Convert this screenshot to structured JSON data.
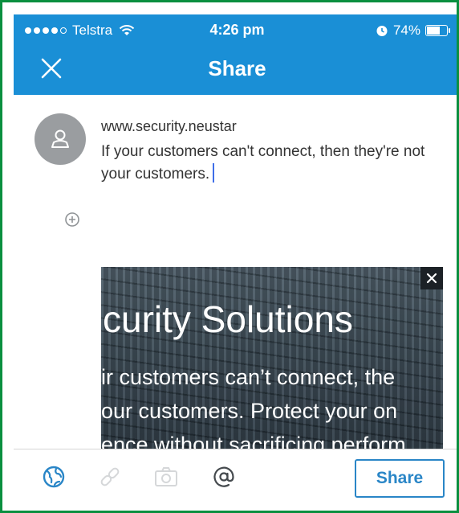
{
  "status_bar": {
    "carrier": "Telstra",
    "time": "4:26 pm",
    "battery": "74%",
    "battery_level": 0.74,
    "signal_bars": 4,
    "icons": [
      "wifi-icon",
      "alarm-icon",
      "battery-icon"
    ]
  },
  "nav": {
    "title": "Share",
    "close_icon": "close-icon"
  },
  "post": {
    "url": "www.security.neustar",
    "text": "If your customers can't connect, then they're not your customers.",
    "avatar_icon": "person-icon",
    "add_icon": "plus-circle-icon"
  },
  "preview": {
    "line1": "curity Solutions",
    "line2": "ir customers can’t connect, the",
    "line3": "our customers. Protect your on",
    "line4": "ence without sacrificing perform",
    "close_icon": "close-icon"
  },
  "toolbar": {
    "share_label": "Share",
    "icons": [
      "globe-icon",
      "link-icon",
      "camera-icon",
      "at-sign-icon"
    ]
  },
  "colors": {
    "header": "#1a8fd6",
    "accent": "#2a86c7",
    "border": "#0a8f3f",
    "caret": "#3f6ee8"
  }
}
